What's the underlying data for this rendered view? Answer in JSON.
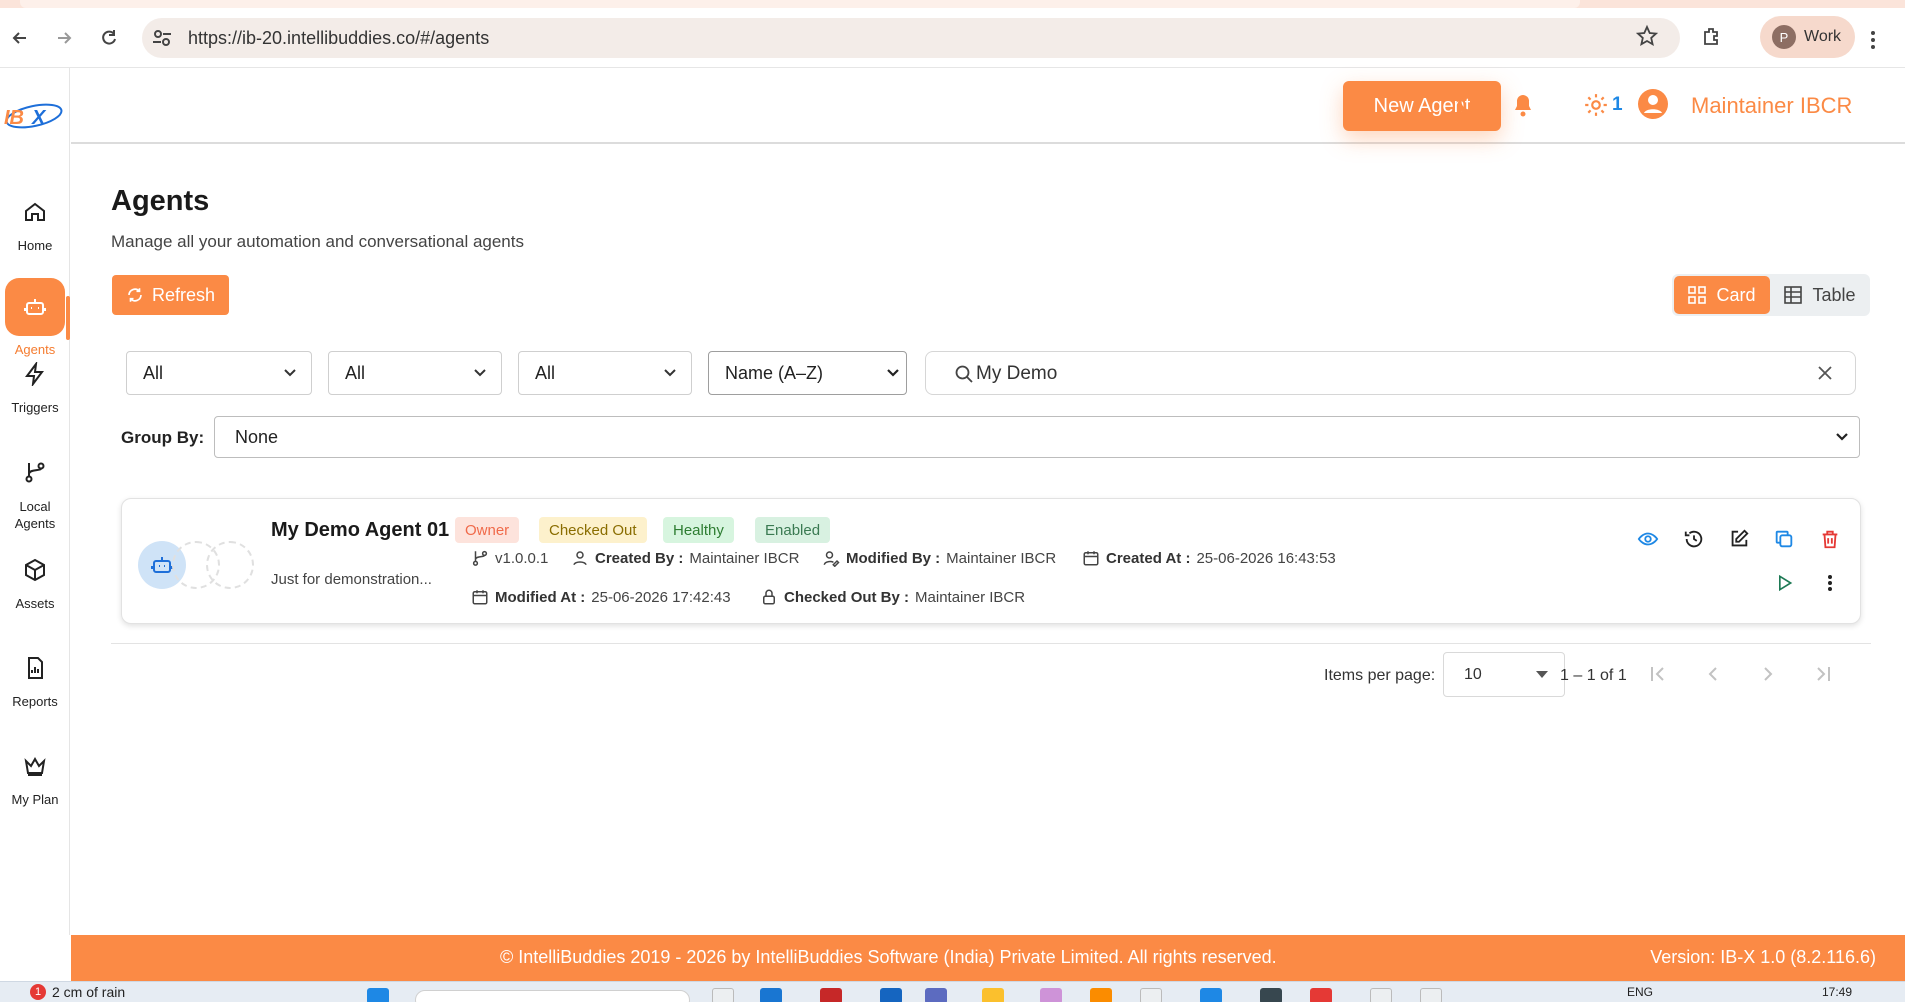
{
  "browser": {
    "url": "https://ib-20.intellibuddies.co/#/agents",
    "profile_initial": "P",
    "profile_label": "Work"
  },
  "sidebar": {
    "logo": "IBX",
    "items": [
      {
        "label": "Home",
        "icon": "home-icon"
      },
      {
        "label": "Agents",
        "icon": "robot-icon",
        "active": true
      },
      {
        "label": "Triggers",
        "icon": "lightning-icon"
      },
      {
        "label": "Local Agents",
        "icon": "branch-icon"
      },
      {
        "label": "Assets",
        "icon": "cube-icon"
      },
      {
        "label": "Reports",
        "icon": "report-icon"
      },
      {
        "label": "My Plan",
        "icon": "crown-icon"
      }
    ]
  },
  "header": {
    "new_agent_label": "New Agent",
    "notification_count": "1",
    "user_name": "Maintainer IBCR"
  },
  "page": {
    "title": "Agents",
    "subtitle": "Manage all your automation and conversational agents",
    "refresh_label": "Refresh",
    "view_card_label": "Card",
    "view_table_label": "Table"
  },
  "filters": {
    "filter1": "All",
    "filter2": "All",
    "filter3": "All",
    "sort": "Name (A–Z)",
    "search_value": "My Demo",
    "group_by_label": "Group By:",
    "group_by_value": "None"
  },
  "agent": {
    "name": "My Demo Agent 01",
    "badges": [
      "Owner",
      "Checked Out",
      "Healthy",
      "Enabled"
    ],
    "description": "Just for demonstration...",
    "version": "v1.0.0.1",
    "created_by_label": "Created By :",
    "created_by": "Maintainer IBCR",
    "modified_by_label": "Modified By :",
    "modified_by": "Maintainer IBCR",
    "created_at_label": "Created At :",
    "created_at": "25-06-2026 16:43:53",
    "modified_at_label": "Modified At :",
    "modified_at": "25-06-2026 17:42:43",
    "checked_out_by_label": "Checked Out By :",
    "checked_out_by": "Maintainer IBCR"
  },
  "pagination": {
    "items_per_page_label": "Items per page:",
    "items_per_page": "10",
    "range": "1 – 1 of 1"
  },
  "footer": {
    "copyright": "© IntelliBuddies 2019 - 2026 by IntelliBuddies Software (India) Private Limited. All rights reserved.",
    "version": "Version: IB-X 1.0 (8.2.116.6)"
  },
  "taskbar": {
    "weather_badge": "1",
    "weather": "2 cm of rain",
    "lang": "ENG",
    "time": "17:49"
  },
  "colors": {
    "accent": "#fb8a45",
    "link_blue": "#1e88e5",
    "delete_red": "#e53935"
  }
}
